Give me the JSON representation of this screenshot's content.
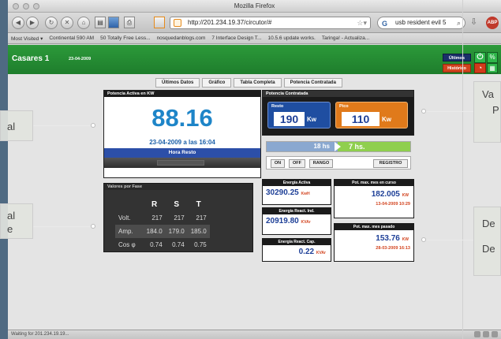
{
  "browser": {
    "window_title": "Mozilla Firefox",
    "url": "http://201.234.19.37/circutor/#",
    "search_text": "usb resident evil 5",
    "bookmarks": [
      "Most Visited ▾",
      "Continental 590 AM",
      "50 Totally Free Less...",
      "nosquedanblogs.com",
      "7 Interface Design T...",
      "10.5.6 update works.",
      "Taringa! - Actualiza..."
    ],
    "status_text": "Waiting for 201.234.19.19..."
  },
  "header": {
    "title": "Casares 1",
    "date": "23-04-2009",
    "btn_ultimos": "Últimos",
    "btn_historico": "Histórico"
  },
  "tabs": [
    "Últimos Datos",
    "Gráfico",
    "Tabla Completa",
    "Potencia Contratada"
  ],
  "potencia_activa": {
    "title": "Potencia Activa en KW",
    "value": "88.16",
    "datetime": "23-04-2009  a las  16:04",
    "hora": "Hora Resto"
  },
  "potencia_contratada": {
    "title": "Potencia Contratada",
    "resto_label": "Resto",
    "resto_value": "190",
    "pico_label": "Pico",
    "pico_value": "110",
    "unit": "Kw",
    "colors": {
      "resto": "#1f4ea1",
      "pico": "#e07a1b"
    }
  },
  "horario": {
    "from": "18 hs",
    "to": "7 hs."
  },
  "controls": {
    "on": "ON",
    "off": "OFF",
    "rango": "RANGO",
    "registro": "REGISTRO"
  },
  "fase": {
    "title": "Valores por Fase",
    "headers": [
      "R",
      "S",
      "T"
    ],
    "rows": [
      {
        "label": "Volt.",
        "values": [
          "217",
          "217",
          "217"
        ]
      },
      {
        "label": "Amp.",
        "values": [
          "184.0",
          "179.0",
          "185.0"
        ]
      },
      {
        "label": "Cos φ",
        "values": [
          "0.74",
          "0.74",
          "0.75"
        ]
      }
    ]
  },
  "energia": {
    "activa_title": "Energía Activa",
    "activa_value": "30290.25",
    "activa_unit": "KwH",
    "react_ind_title": "Energía React. Ind.",
    "react_ind_value": "20919.80",
    "react_ind_unit": "KVAr",
    "react_cap_title": "Energía React. Cap.",
    "react_cap_value": "0.22",
    "react_cap_unit": "KVAr"
  },
  "pot_max": {
    "curso_title": "Pot. max. mes en curso",
    "curso_value": "182.005",
    "curso_unit": "KW",
    "curso_date": "13-04-2009 10:29",
    "pasado_title": "Pot. max. mes pasado",
    "pasado_value": "153.76",
    "pasado_unit": "KW",
    "pasado_date": "28-03-2009 16:13"
  },
  "callouts": {
    "left_top": "al",
    "left_bottom_1": "al",
    "left_bottom_2": "e",
    "right_top_1": "Va",
    "right_top_2": "P",
    "right_bottom_1": "De",
    "right_bottom_2": "De"
  }
}
